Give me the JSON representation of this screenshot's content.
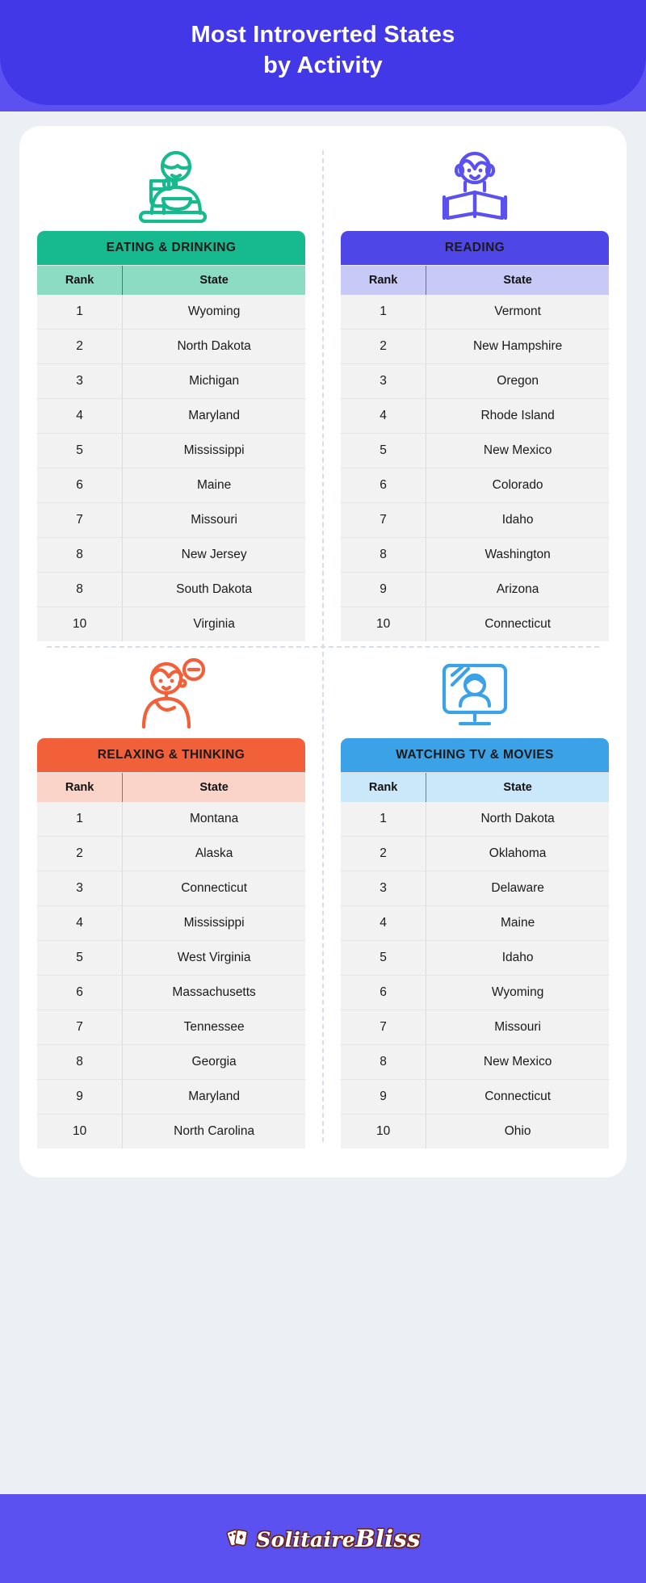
{
  "header": {
    "title_line1": "Most Introverted States",
    "title_line2": "by Activity",
    "bg_color": "#4338e8",
    "bg_outer_color": "#5b51f0"
  },
  "columns": {
    "rank_label": "Rank",
    "state_label": "State"
  },
  "tables": [
    {
      "id": "eating-drinking",
      "title": "EATING & DRINKING",
      "icon": "person-eating-bowl-icon",
      "header_color": "#17b98f",
      "subheader_color": "#8bdcc3",
      "icon_color": "#17b98f",
      "rows": [
        {
          "rank": "1",
          "state": "Wyoming"
        },
        {
          "rank": "2",
          "state": "North Dakota"
        },
        {
          "rank": "3",
          "state": "Michigan"
        },
        {
          "rank": "4",
          "state": "Maryland"
        },
        {
          "rank": "5",
          "state": "Mississippi"
        },
        {
          "rank": "6",
          "state": "Maine"
        },
        {
          "rank": "7",
          "state": "Missouri"
        },
        {
          "rank": "8",
          "state": "New Jersey"
        },
        {
          "rank": "8",
          "state": "South Dakota"
        },
        {
          "rank": "10",
          "state": "Virginia"
        }
      ]
    },
    {
      "id": "reading",
      "title": "READING",
      "icon": "person-reading-book-icon",
      "header_color": "#4f46e8",
      "subheader_color": "#c7c9f7",
      "icon_color": "#5b51f0",
      "rows": [
        {
          "rank": "1",
          "state": "Vermont"
        },
        {
          "rank": "2",
          "state": "New Hampshire"
        },
        {
          "rank": "3",
          "state": "Oregon"
        },
        {
          "rank": "4",
          "state": "Rhode Island"
        },
        {
          "rank": "5",
          "state": "New Mexico"
        },
        {
          "rank": "6",
          "state": "Colorado"
        },
        {
          "rank": "7",
          "state": "Idaho"
        },
        {
          "rank": "8",
          "state": "Washington"
        },
        {
          "rank": "9",
          "state": "Arizona"
        },
        {
          "rank": "10",
          "state": "Connecticut"
        }
      ]
    },
    {
      "id": "relaxing-thinking",
      "title": "RELAXING & THINKING",
      "icon": "person-thinking-icon",
      "header_color": "#f2603a",
      "subheader_color": "#fad4c9",
      "icon_color": "#f2603a",
      "rows": [
        {
          "rank": "1",
          "state": "Montana"
        },
        {
          "rank": "2",
          "state": "Alaska"
        },
        {
          "rank": "3",
          "state": "Connecticut"
        },
        {
          "rank": "4",
          "state": "Mississippi"
        },
        {
          "rank": "5",
          "state": "West Virginia"
        },
        {
          "rank": "6",
          "state": "Massachusetts"
        },
        {
          "rank": "7",
          "state": "Tennessee"
        },
        {
          "rank": "8",
          "state": "Georgia"
        },
        {
          "rank": "9",
          "state": "Maryland"
        },
        {
          "rank": "10",
          "state": "North Carolina"
        }
      ]
    },
    {
      "id": "watching-tv-movies",
      "title": "WATCHING TV & MOVIES",
      "icon": "person-watching-tv-icon",
      "header_color": "#3ba2e8",
      "subheader_color": "#cbe7fa",
      "icon_color": "#3ba2e8",
      "rows": [
        {
          "rank": "1",
          "state": "North Dakota"
        },
        {
          "rank": "2",
          "state": "Oklahoma"
        },
        {
          "rank": "3",
          "state": "Delaware"
        },
        {
          "rank": "4",
          "state": "Maine"
        },
        {
          "rank": "5",
          "state": "Idaho"
        },
        {
          "rank": "6",
          "state": "Wyoming"
        },
        {
          "rank": "7",
          "state": "Missouri"
        },
        {
          "rank": "8",
          "state": "New Mexico"
        },
        {
          "rank": "9",
          "state": "Connecticut"
        },
        {
          "rank": "10",
          "state": "Ohio"
        }
      ]
    }
  ],
  "footer": {
    "brand_part1": "Solitaire",
    "brand_part2": "Bliss",
    "bg_color": "#5b51f0",
    "logo_icon": "playing-cards-icon"
  }
}
